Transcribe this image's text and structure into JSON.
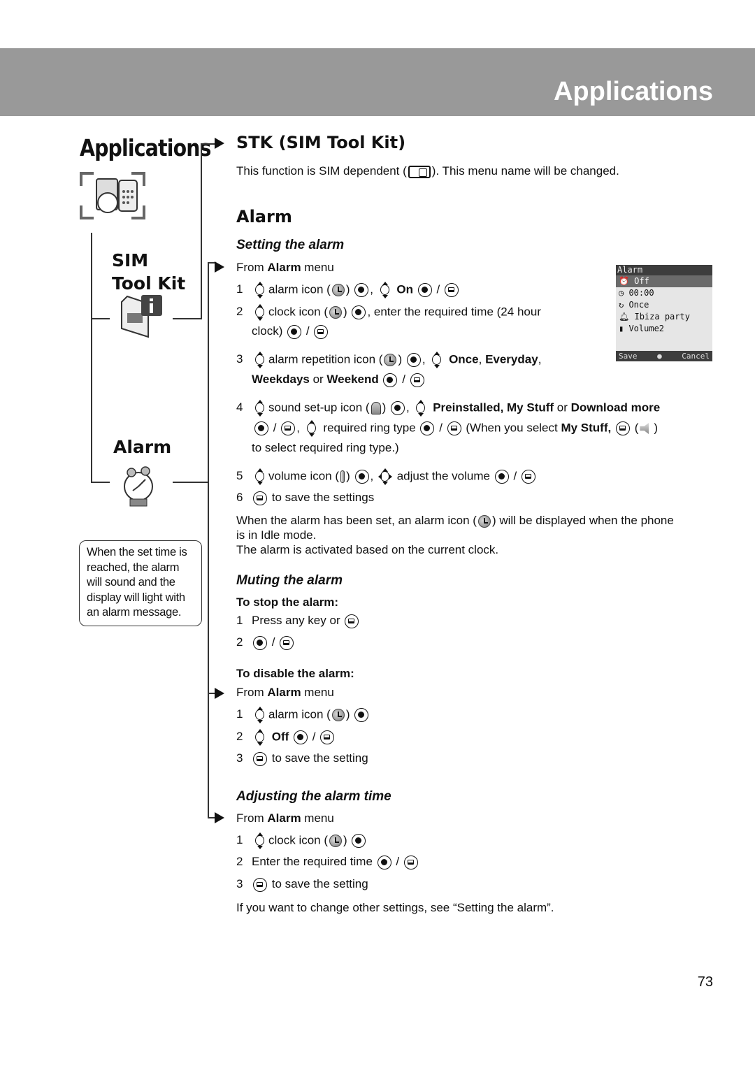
{
  "header": {
    "title": "Applications"
  },
  "nav": {
    "title": "Applications",
    "items": [
      {
        "label_line1": "SIM",
        "label_line2": "Tool Kit"
      },
      {
        "label": "Alarm"
      }
    ]
  },
  "note": {
    "text": "When the set time is reached, the alarm will sound and the display will light with an alarm message."
  },
  "stk": {
    "heading": "STK (SIM Tool Kit)",
    "desc_before": "This function is SIM dependent (",
    "desc_after": "). This menu name will be changed."
  },
  "alarm": {
    "heading": "Alarm",
    "setting": {
      "heading": "Setting the alarm",
      "from": {
        "pre": "From ",
        "bold": "Alarm",
        "post": " menu"
      },
      "steps": [
        {
          "n": "1",
          "t1": "alarm icon (",
          "t2": ")",
          "t3": ",",
          "bold": "On",
          "slash": "/"
        },
        {
          "n": "2",
          "t1": "clock icon (",
          "t2": ")",
          "t3": ", enter the required time (24 hour",
          "t4": "clock)",
          "slash": "/"
        },
        {
          "n": "3",
          "t1": "alarm repetition icon (",
          "t2": ")",
          "t3": ",",
          "b1": "Once",
          "c1": ", ",
          "b2": "Everyday",
          "c2": ",",
          "b3": "Weekdays",
          "or": " or ",
          "b4": "Weekend",
          "slash": "/"
        },
        {
          "n": "4",
          "t1": "sound set-up icon (",
          "t2": ")",
          "t3": ",",
          "b1": "Preinstalled, My Stuff",
          "or": " or ",
          "b2": "Download more",
          "slash": "/",
          "t4": ",",
          "t5": "required ring type",
          "t6": "(When you select ",
          "b3": "My Stuff,",
          "t7": "(",
          "t8": ")",
          "t9": "to select required ring type.)"
        },
        {
          "n": "5",
          "t1": "volume icon (",
          "t2": ")",
          "t3": ",",
          "t4": "adjust the volume",
          "slash": "/"
        },
        {
          "n": "6",
          "t1": "to save the settings"
        }
      ],
      "after1": "When the alarm has been set, an alarm icon (",
      "after2": ") will be displayed when the phone",
      "after3": "is in Idle mode.",
      "after4": "The alarm is activated based on the current clock."
    },
    "muting": {
      "heading": "Muting the alarm",
      "stop_heading": "To stop the alarm:",
      "stop_steps": [
        {
          "n": "1",
          "t1": "Press any key or"
        },
        {
          "n": "2",
          "slash": "/"
        }
      ],
      "disable_heading": "To disable the alarm:",
      "from": {
        "pre": "From ",
        "bold": "Alarm",
        "post": " menu"
      },
      "disable_steps": [
        {
          "n": "1",
          "t1": "alarm icon (",
          "t2": ")"
        },
        {
          "n": "2",
          "bold": "Off",
          "slash": "/"
        },
        {
          "n": "3",
          "t1": "to save the setting"
        }
      ]
    },
    "adjusting": {
      "heading": "Adjusting the alarm time",
      "from": {
        "pre": "From ",
        "bold": "Alarm",
        "post": " menu"
      },
      "steps": [
        {
          "n": "1",
          "t1": "clock icon (",
          "t2": ")"
        },
        {
          "n": "2",
          "t1": "Enter the required time",
          "slash": "/"
        },
        {
          "n": "3",
          "t1": "to save the setting"
        }
      ],
      "footer": "If you want to change other settings, see “Setting the alarm”."
    }
  },
  "phone_screen": {
    "title": "Alarm",
    "rows": [
      "Off",
      "00:00",
      "Once",
      "Ibiza party",
      "Volume2"
    ],
    "softkey_left": "Save",
    "softkey_right": "Cancel"
  },
  "page": {
    "number": "73"
  }
}
